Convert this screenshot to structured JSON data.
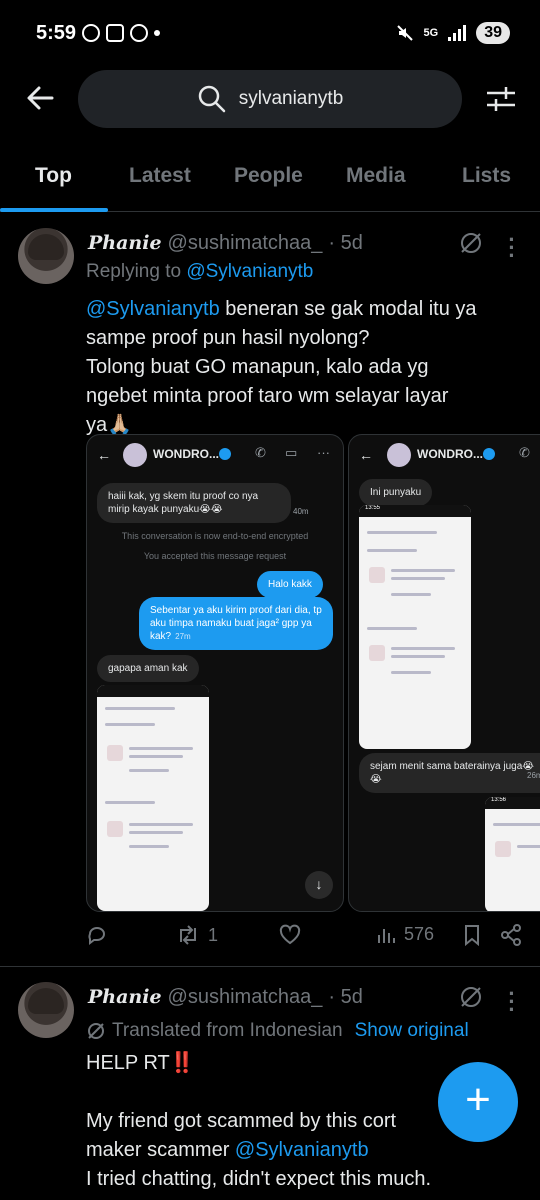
{
  "status_bar": {
    "time": "5:59",
    "network": "5G",
    "battery": "39"
  },
  "search": {
    "query": "sylvanianytb"
  },
  "tabs": [
    {
      "label": "Top",
      "active": true
    },
    {
      "label": "Latest",
      "active": false
    },
    {
      "label": "People",
      "active": false
    },
    {
      "label": "Media",
      "active": false
    },
    {
      "label": "Lists",
      "active": false
    }
  ],
  "tweet1": {
    "display_name": "Phanie",
    "handle": "@sushimatchaa_",
    "time": "· 5d",
    "replying_prefix": "Replying to",
    "replying_to": "@Sylvanianytb",
    "mention": "@Sylvanianytb",
    "text_lines": [
      " beneran se gak modal itu ya",
      "sampe proof pun hasil nyolong?",
      "Tolong buat GO manapun, kalo ada yg",
      "ngebet minta proof taro wm selayar layar",
      "ya🙏🏼"
    ],
    "media": {
      "left": {
        "chat_name": "WONDRO...",
        "msg_in_1": "haiii kak, yg skem itu proof co nya mirip kayak punyaku😭😭",
        "msg_in_1_time": "40m",
        "sys_1": "This conversation is now end-to-end encrypted",
        "sys_2": "You accepted this message request",
        "msg_out_1": "Halo kakk",
        "msg_out_2": "Sebentar ya aku kirim proof dari dia, tp aku timpa namaku buat jaga² gpp ya kak?",
        "msg_out_2_time": "27m",
        "msg_in_2": "gapapa aman kak"
      },
      "right": {
        "chat_name": "WONDRO...",
        "msg_in_1": "Ini punyaku",
        "msg_in_2": "sejam menit sama baterainya juga😭😭",
        "msg_in_2_time": "26m",
        "screenshot_time": "13:55",
        "screenshot_time_2": "13:56"
      }
    },
    "actions": {
      "replies": "",
      "reposts": "1",
      "likes": "",
      "views": "576"
    }
  },
  "tweet2": {
    "display_name": "Phanie",
    "handle": "@sushimatchaa_",
    "time": "· 5d",
    "translated_label": "Translated from Indonesian",
    "show_original": "Show original",
    "line1": "HELP RT‼️",
    "line2": "My friend got scammed by this cort",
    "line3_prefix": "maker scammer ",
    "line3_mention": "@Sylvanianytb",
    "line4": "I tried chatting, didn't expect this much."
  },
  "colors": {
    "accent": "#1d9bf0",
    "background": "#000000",
    "muted": "#71767b"
  }
}
